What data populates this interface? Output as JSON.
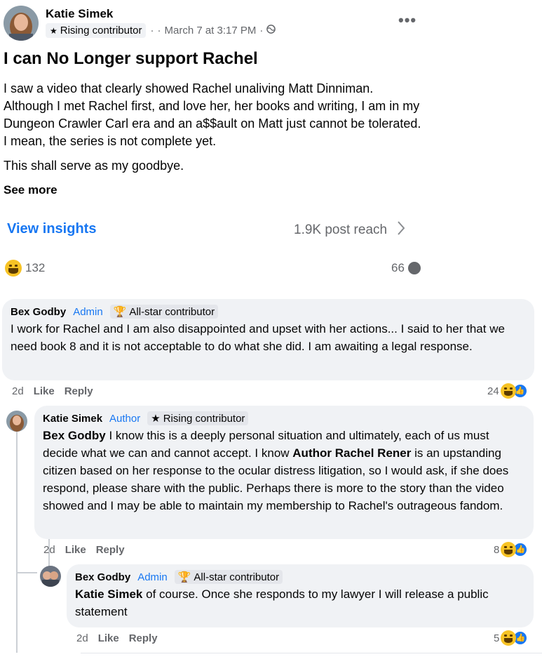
{
  "post": {
    "author": "Katie Simek",
    "badge": "Rising contributor",
    "dot_sep": "·",
    "date": "March 7 at 3:17 PM",
    "audience_icon": "globe-icon",
    "more_icon": "•••",
    "title": "I can No Longer support Rachel",
    "body_p1": "I saw a video that clearly showed Rachel unaliving Matt Dinniman. Although I met Rachel first, and love her, her books and writing, I am in my Dungeon Crawler Carl era and an a$$ault on Matt just cannot be tolerated. I mean, the series is not complete yet.",
    "body_p2": "This shall serve as my goodbye.",
    "see_more": "See more",
    "view_insights": "View insights",
    "post_reach": "1.9K post reach",
    "reaction_count": "132",
    "comment_count": "66"
  },
  "comments": [
    {
      "name": "Bex Godby",
      "role": "Admin",
      "badge": "All-star contributor",
      "text": "I work for Rachel and I am also disappointed and upset with her actions... I said to her that we need book 8 and it is not acceptable to do what she did. I am awaiting a legal response.",
      "time": "2d",
      "like": "Like",
      "reply": "Reply",
      "reactions": "24"
    },
    {
      "name": "Katie Simek",
      "role": "Author",
      "badge": "Rising contributor",
      "mention": "Bex Godby",
      "text_a": " I know this is a deeply personal situation and ultimately, each of us must decide what we can and cannot accept. I know ",
      "mention2": "Author Rachel Rener",
      "text_b": " is an upstanding citizen based on her response to the ocular distress litigation, so I would ask, if she does respond, please share with the public. Perhaps there is more to the story than the video showed and I may be able to maintain my membership to Rachel's outrageous fandom.",
      "time": "2d",
      "like": "Like",
      "reply": "Reply",
      "reactions": "8"
    },
    {
      "name": "Bex Godby",
      "role": "Admin",
      "badge": "All-star contributor",
      "mention": "Katie Simek",
      "text": " of course. Once she responds to my lawyer I will release a public statement",
      "time": "2d",
      "like": "Like",
      "reply": "Reply",
      "reactions": "5"
    }
  ],
  "colors": {
    "accent": "#1877f2",
    "muted": "#65676b",
    "bubble": "#f0f2f5"
  }
}
